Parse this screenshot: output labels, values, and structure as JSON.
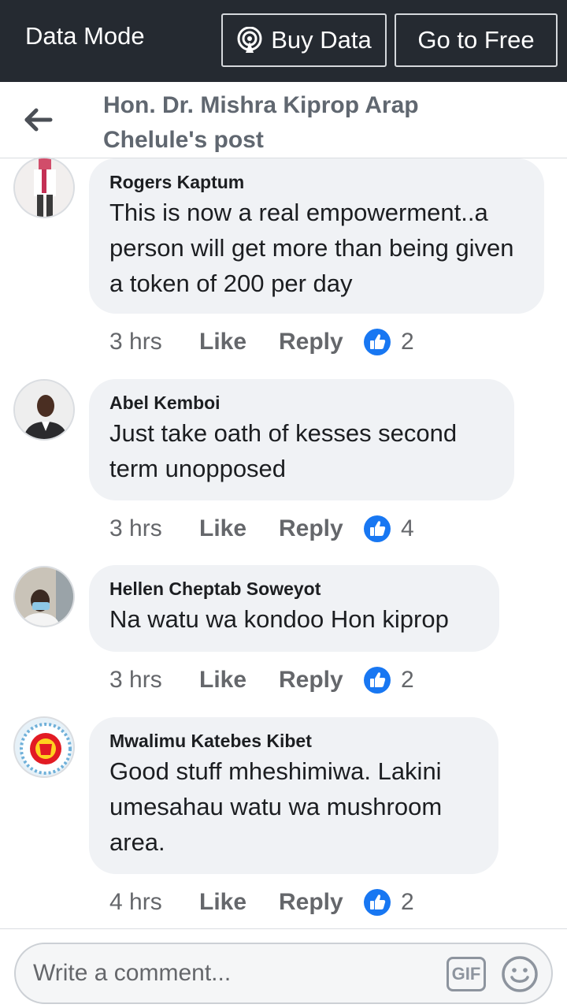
{
  "topbar": {
    "mode_label": "Data Mode",
    "buy_label": "Buy Data",
    "free_label": "Go to Free"
  },
  "header": {
    "title": "Hon. Dr. Mishra Kiprop Arap Chelule's post"
  },
  "comments": [
    {
      "author": "Rogers Kaptum",
      "text": "This is now a real empowerment..a person will get more than being given a token of 200 per day",
      "time": "3 hrs",
      "like": "Like",
      "reply": "Reply",
      "reactions": "2"
    },
    {
      "author": "Abel Kemboi",
      "text": "Just take oath of kesses second term unopposed",
      "time": "3 hrs",
      "like": "Like",
      "reply": "Reply",
      "reactions": "4"
    },
    {
      "author": "Hellen Cheptab Soweyot",
      "text": "Na watu wa kondoo Hon kiprop",
      "time": "3 hrs",
      "like": "Like",
      "reply": "Reply",
      "reactions": "2"
    },
    {
      "author": "Mwalimu Katebes Kibet",
      "text": "Good stuff mheshimiwa. Lakini umesahau watu wa mushroom area.",
      "time": "4 hrs",
      "like": "Like",
      "reply": "Reply",
      "reactions": "2"
    }
  ],
  "composer": {
    "placeholder": "Write a comment...",
    "gif_label": "GIF"
  },
  "icons": {
    "back": "back-arrow-icon",
    "buy_data": "broadcast-icon",
    "reaction": "thumbs-up-icon",
    "emoji": "smiley-icon"
  },
  "colors": {
    "topbar_bg": "#252a31",
    "bubble_bg": "#f0f2f5",
    "like_blue": "#1877f2"
  }
}
